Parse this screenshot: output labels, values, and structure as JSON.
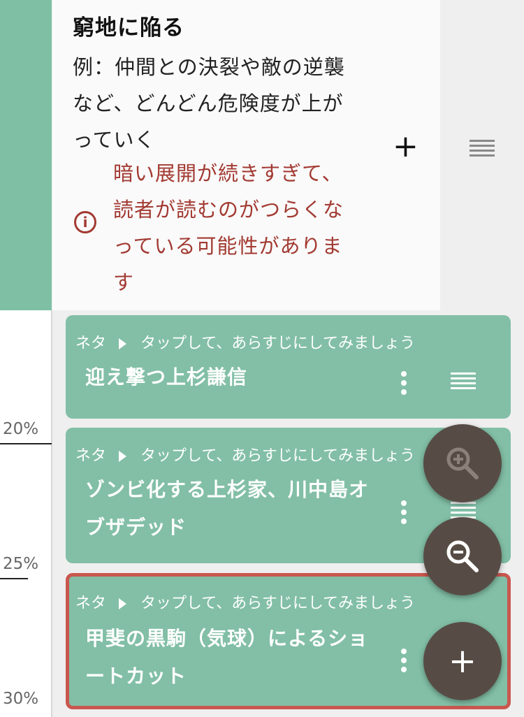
{
  "top_card": {
    "title": "窮地に陥る",
    "description": "例：仲間との決裂や敵の逆襲など、どんどん危険度が上がっていく",
    "add_label": "+",
    "warning": "暗い展開が続きすぎて、読者が読むのがつらくなっている可能性があります"
  },
  "ruler": {
    "ticks": [
      "20%",
      "25%",
      "30%"
    ]
  },
  "cards": [
    {
      "label": "ネタ",
      "hint": "タップして、あらすじにしてみましょう",
      "title": "迎え撃つ上杉謙信"
    },
    {
      "label": "ネタ",
      "hint": "タップして、あらすじにしてみましょう",
      "title": "ゾンビ化する上杉家、川中島オブザデッド"
    },
    {
      "label": "ネタ",
      "hint": "タップして、あらすじにしてみましょう",
      "title": "甲斐の黒駒（気球）によるショートカット"
    }
  ],
  "fabs": {
    "add_label": "+"
  },
  "colors": {
    "accent_green": "#82bfa6",
    "warning_red": "#a23a32",
    "selected_border": "#c9574f",
    "fab": "#574c45"
  }
}
